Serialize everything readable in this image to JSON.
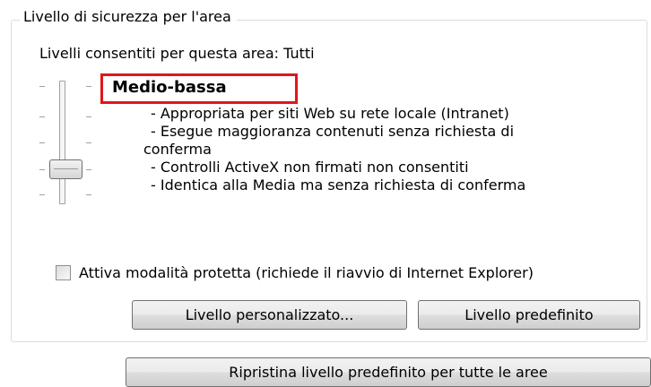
{
  "security_group": {
    "title": "Livello di sicurezza per l'area",
    "allowed_levels": "Livelli consentiti per questa area: Tutti",
    "slider": {
      "position": "Medio-bassa"
    },
    "level_name": "Medio-bassa",
    "description": [
      "- Appropriata per siti Web su rete locale (Intranet)",
      "- Esegue maggioranza contenuti senza richiesta di",
      "conferma",
      "- Controlli ActiveX non firmati non consentiti",
      "- Identica alla Media ma senza richiesta di conferma"
    ],
    "protected_mode": {
      "label": "Attiva modalità protetta (richiede il riavvio di Internet Explorer)",
      "checked": false
    },
    "buttons": {
      "custom_level": "Livello personalizzato...",
      "default_level": "Livello predefinito"
    }
  },
  "reset_all_button": "Ripristina livello predefinito per tutte le aree",
  "colors": {
    "highlight_border": "#e0161b",
    "groupbox_border": "#d5dfe5"
  }
}
